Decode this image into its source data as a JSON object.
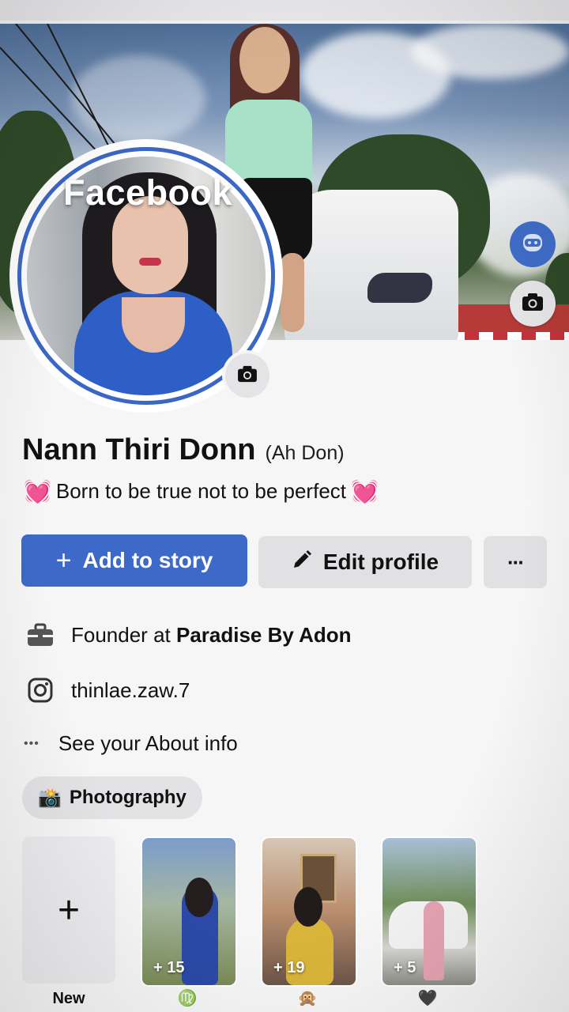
{
  "cover": {
    "brand_watermark": "Facebook",
    "avatar_button_icon": "avatar-face-icon",
    "camera_button_icon": "camera-icon"
  },
  "profile": {
    "name": "Nann Thiri Donn",
    "alternate_name": "(Ah Don)",
    "bio_text": "Born to be true not to be perfect",
    "bio_emoji": "💓",
    "profile_camera_icon": "camera-icon"
  },
  "actions": {
    "add_story_label": "Add to story",
    "add_story_icon": "+",
    "edit_profile_label": "Edit profile",
    "more_label": "···"
  },
  "details": {
    "work_prefix": "Founder at",
    "work_company": "Paradise By Adon",
    "instagram": "thinlae.zaw.7",
    "about_link": "See your About info",
    "about_dots": "•••"
  },
  "hobby_chip": {
    "emoji": "📸",
    "label": "Photography"
  },
  "featured": {
    "new_plus": "+",
    "new_label": "New",
    "items": [
      {
        "count": "+ 15",
        "label": "♍"
      },
      {
        "count": "+ 19",
        "label": "🙊"
      },
      {
        "count": "+ 5",
        "label": "🖤"
      }
    ]
  },
  "colors": {
    "accent_blue": "#3d6ac8",
    "page_bg": "#f6f6f7",
    "button_gray": "#e1e1e4"
  }
}
